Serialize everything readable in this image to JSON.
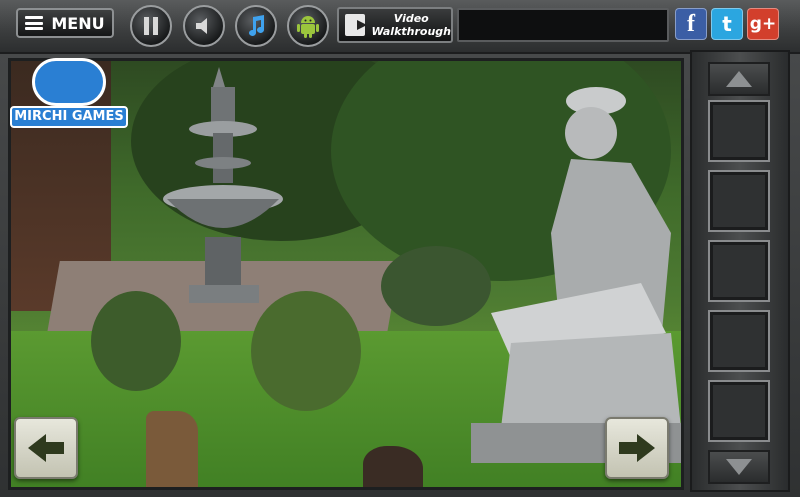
{
  "toolbar": {
    "menu_label": "MENU",
    "video_line1": "Video",
    "video_line2": "Walkthrough"
  },
  "social": {
    "facebook": "f",
    "twitter": "t",
    "googleplus": "g+"
  },
  "logo": {
    "text": "MIRCHI GAMES"
  },
  "colors": {
    "facebook": "#3b5ea5",
    "twitter": "#2ba6e0",
    "googleplus": "#d23f2c",
    "logo_blue": "#2a7fd3"
  },
  "icons": [
    "menu-icon",
    "pause-icon",
    "speaker-icon",
    "music-note-icon",
    "android-icon",
    "video-film-icon",
    "arrow-left-icon",
    "arrow-right-icon",
    "arrow-up-icon",
    "arrow-down-icon"
  ]
}
